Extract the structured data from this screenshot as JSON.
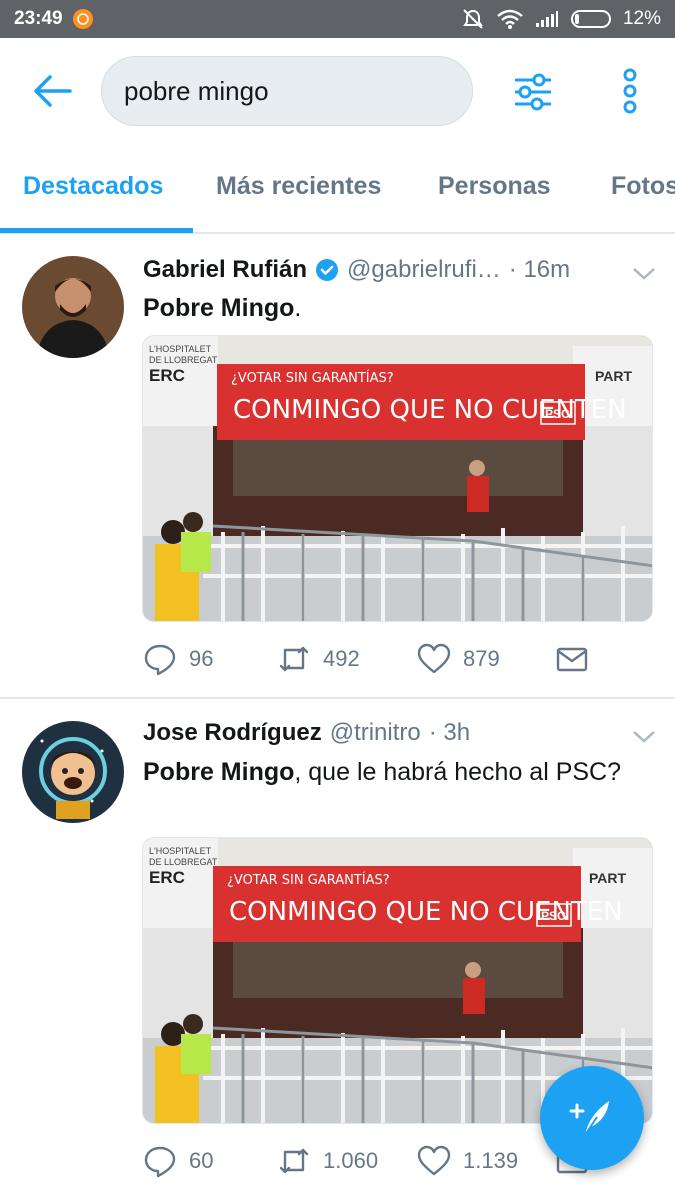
{
  "status_bar": {
    "time": "23:49",
    "battery": "12%"
  },
  "search": {
    "query": "pobre mingo"
  },
  "tabs": [
    {
      "label": "Destacados"
    },
    {
      "label": "Más recientes"
    },
    {
      "label": "Personas"
    },
    {
      "label": "Fotos"
    }
  ],
  "tweets": [
    {
      "name": "Gabriel Rufián",
      "handle": "@gabrielrufi…",
      "time": "· 16m",
      "text_bold": "Pobre Mingo",
      "text_rest": ".",
      "banner": {
        "top": "¿VOTAR SIN GARANTÍAS?",
        "main": "CONMINGO QUE NO CUENTEN",
        "party": "PSC"
      },
      "sign_left": {
        "line1": "L'HOSPITALET",
        "line2": "DE LLOBREGAT",
        "line3": "ERC"
      },
      "sign_right": "PART",
      "replies": "96",
      "retweets": "492",
      "likes": "879"
    },
    {
      "name": "Jose Rodríguez",
      "handle": "@trinitro",
      "time": "· 3h",
      "text_bold": "Pobre Mingo",
      "text_rest": ", que le habrá hecho al PSC?",
      "banner": {
        "top": "¿VOTAR SIN GARANTÍAS?",
        "main": "CONMINGO QUE NO CUENTEN",
        "party": "PSC"
      },
      "sign_left": {
        "line1": "L'HOSPITALET",
        "line2": "DE LLOBREGAT",
        "line3": "ERC"
      },
      "sign_right": "PART",
      "replies": "60",
      "retweets": "1.060",
      "likes": "1.139"
    }
  ],
  "colors": {
    "accent": "#1da1f2",
    "secondary_text": "#657786",
    "banner_red": "#d8312f"
  }
}
